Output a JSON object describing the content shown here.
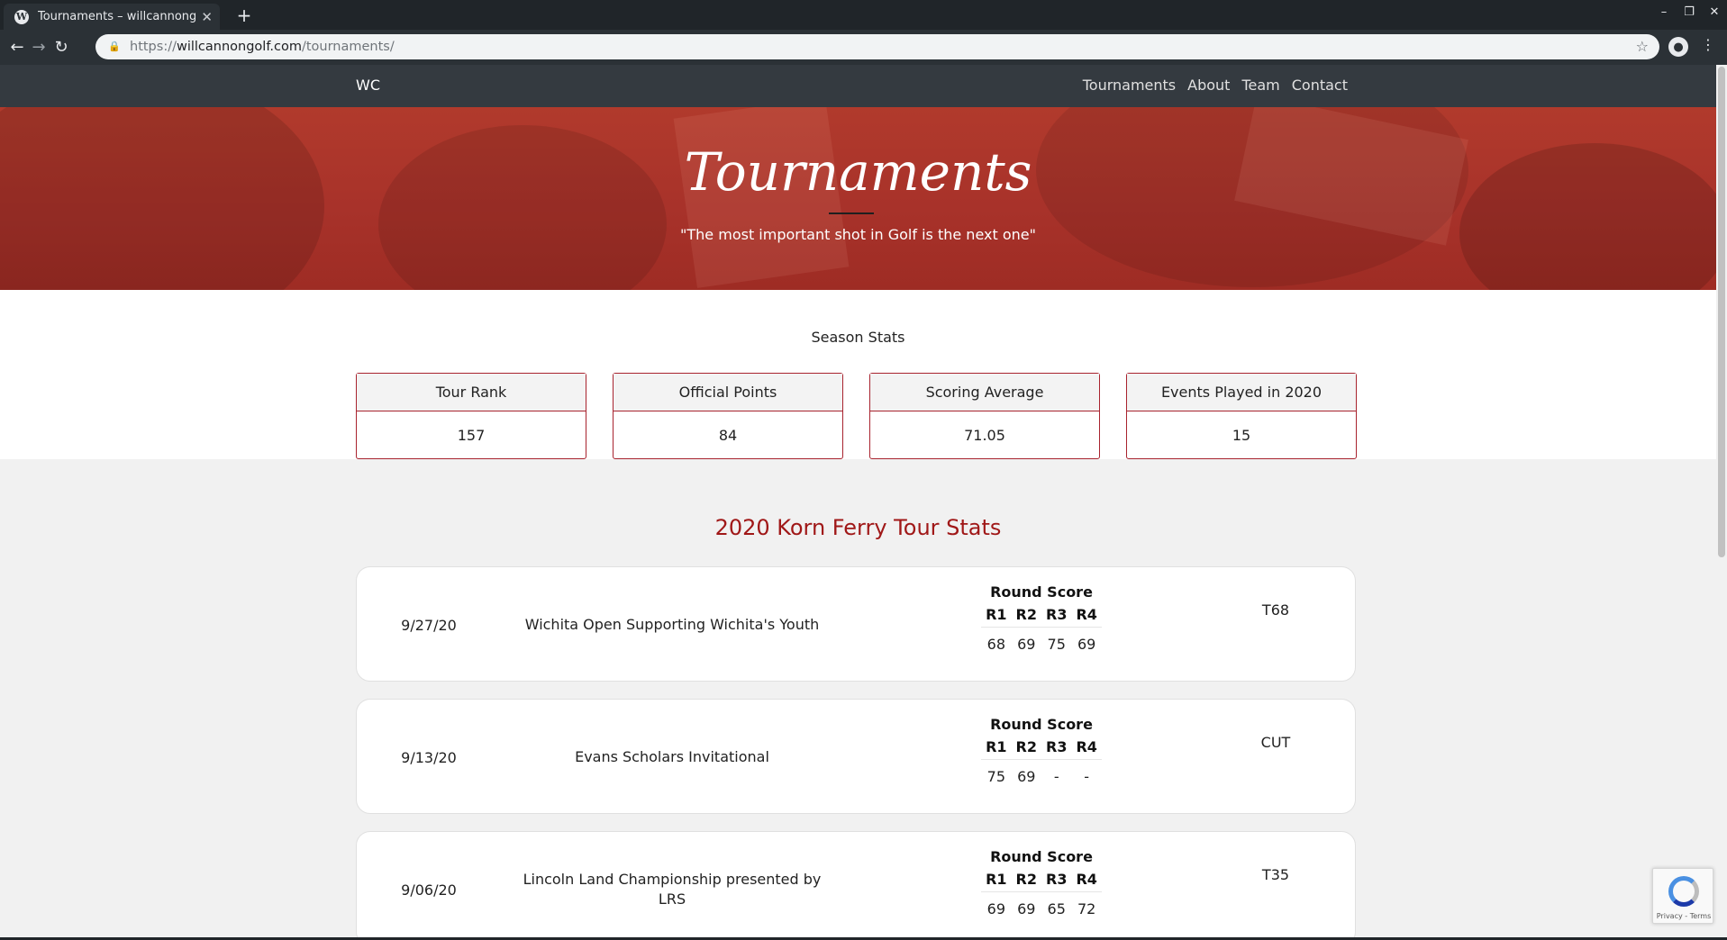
{
  "browser": {
    "tab_title": "Tournaments – willcannongolf",
    "favicon": "wordpress-icon",
    "url_scheme": "https://",
    "url_host": "willcannongolf.com",
    "url_path": "/tournaments/"
  },
  "site": {
    "brand": "WC",
    "nav": [
      "Tournaments",
      "About",
      "Team",
      "Contact"
    ]
  },
  "hero": {
    "title": "Tournaments",
    "quote": "\"The most important shot in Golf is the next one\""
  },
  "season_stats": {
    "heading": "Season Stats",
    "cards": [
      {
        "label": "Tour Rank",
        "value": "157"
      },
      {
        "label": "Official Points",
        "value": "84"
      },
      {
        "label": "Scoring Average",
        "value": "71.05"
      },
      {
        "label": "Events Played in 2020",
        "value": "15"
      }
    ]
  },
  "tour_stats": {
    "heading": "2020 Korn Ferry Tour Stats",
    "score_caption": "Round Score",
    "round_headers": [
      "R1",
      "R2",
      "R3",
      "R4"
    ],
    "events": [
      {
        "date": "9/27/20",
        "name": "Wichita Open Supporting Wichita's Youth",
        "rounds": [
          "68",
          "69",
          "75",
          "69"
        ],
        "finish": "T68"
      },
      {
        "date": "9/13/20",
        "name": "Evans Scholars Invitational",
        "rounds": [
          "75",
          "69",
          "-",
          "-"
        ],
        "finish": "CUT"
      },
      {
        "date": "9/06/20",
        "name": "Lincoln Land Championship presented by LRS",
        "rounds": [
          "69",
          "69",
          "65",
          "72"
        ],
        "finish": "T35"
      }
    ]
  },
  "recaptcha": {
    "terms": "Privacy - Terms"
  },
  "colors": {
    "accent": "#a01818",
    "hero": "#a8322a",
    "nav": "#343a40"
  }
}
